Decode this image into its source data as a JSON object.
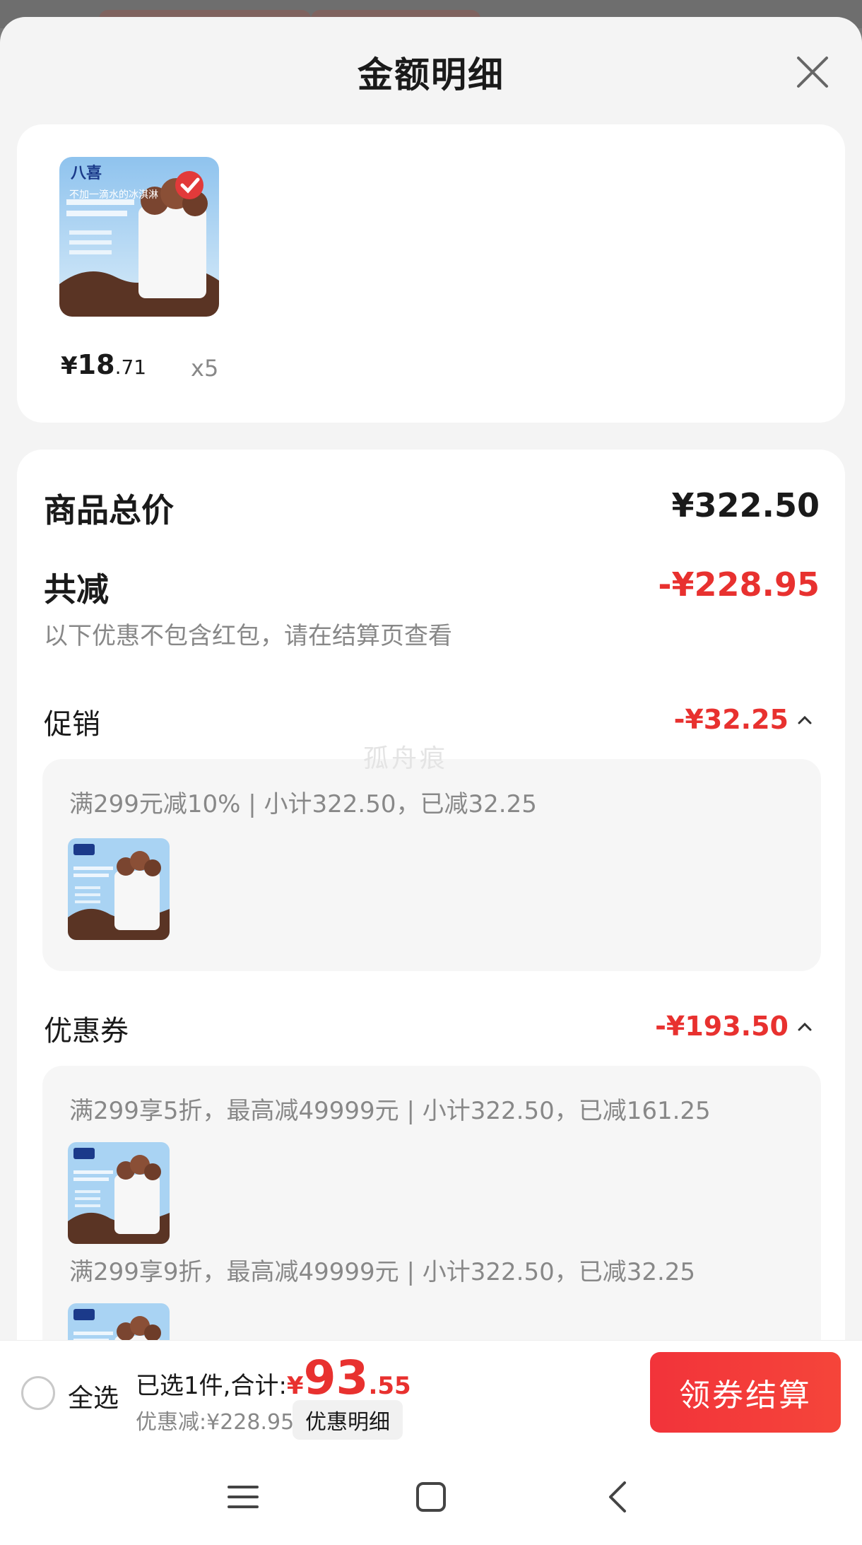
{
  "sheet": {
    "title": "金额明细"
  },
  "product": {
    "image_text": {
      "brand": "八喜",
      "headline": "不加一滴水的冰淇淋"
    },
    "price": {
      "currency": "¥",
      "integer": "18",
      "decimal": ".71"
    },
    "quantity": "x5"
  },
  "summary": {
    "total_label": "商品总价",
    "total_value": "¥322.50",
    "reduced_label": "共减",
    "reduced_value": "-¥228.95",
    "note": "以下优惠不包含红包，请在结算页查看"
  },
  "promotion": {
    "label": "促销",
    "value": "-¥32.25",
    "items": [
      {
        "text": "满299元减10% | 小计322.50，已减32.25"
      }
    ]
  },
  "coupons": {
    "label": "优惠券",
    "value": "-¥193.50",
    "items": [
      {
        "text": "满299享5折，最高减49999元 | 小计322.50，已减161.25"
      },
      {
        "text": "满299享9折，最高减49999元 | 小计322.50，已减32.25"
      }
    ]
  },
  "watermark": "孤舟痕",
  "bottom_bar": {
    "select_all": "全选",
    "selected_label": "已选1件,合计:",
    "total": {
      "currency": "¥",
      "integer": "93",
      "decimal": ".55"
    },
    "discount_line": "优惠减:¥228.95",
    "discount_detail_button": "优惠明细",
    "checkout_button": "领券结算"
  },
  "nav": [
    "menu-icon",
    "home-square-icon",
    "back-chevron-icon"
  ],
  "colors": {
    "accent_red": "#e8312f",
    "checkout_red": "#f2333a"
  }
}
